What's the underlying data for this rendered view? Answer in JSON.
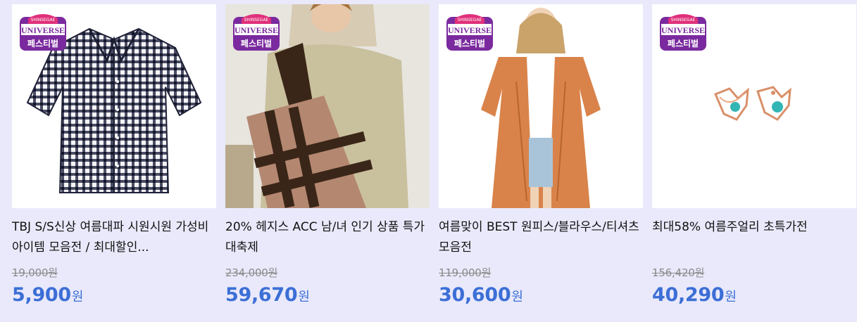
{
  "badge": {
    "brand_text": "SHINSEGAE",
    "title_text": "UNIVERSE",
    "sub_text": "페스티벌"
  },
  "products": [
    {
      "title": "TBJ S/S신상 여름대파 시원시원 가성비 아이템 모음전 / 최대할인...",
      "original_price": "19,000원",
      "sale_price": "5,900",
      "currency": "원",
      "image_icon": "plaid-shirt-icon"
    },
    {
      "title": "20% 헤지스 ACC 남/녀 인기 상품 특가 대축제",
      "original_price": "234,000원",
      "sale_price": "59,670",
      "currency": "원",
      "image_icon": "tote-bag-model-icon"
    },
    {
      "title": "여름맞이 BEST 원피스/블라우스/티셔츠 모음전",
      "original_price": "119,000원",
      "sale_price": "30,600",
      "currency": "원",
      "image_icon": "orange-cardigan-model-icon"
    },
    {
      "title": "최대58% 여름주얼리 초특가전",
      "original_price": "156,420원",
      "sale_price": "40,290",
      "currency": "원",
      "image_icon": "turquoise-earrings-icon"
    }
  ],
  "colors": {
    "background": "#e9e9fb",
    "sale_price": "#3c6fd6",
    "original_price": "#8a8a8a",
    "badge_purple": "#7a2a9e",
    "badge_pink": "#e0307a"
  }
}
